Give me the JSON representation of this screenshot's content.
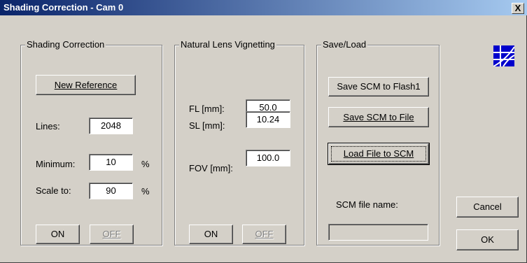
{
  "window": {
    "title": "Shading Correction - Cam 0",
    "close_glyph": "X"
  },
  "shading": {
    "legend": "Shading Correction",
    "new_reference": "New Reference",
    "lines_label": "Lines:",
    "lines_value": "2048",
    "minimum_label": "Minimum:",
    "minimum_value": "10",
    "minimum_unit": "%",
    "scale_label": "Scale to:",
    "scale_value": "90",
    "scale_unit": "%",
    "on_label": "ON",
    "off_label": "OFF"
  },
  "vignetting": {
    "legend": "Natural Lens Vignetting",
    "fl_label": "FL [mm]:",
    "fl_value": "50.0",
    "sl_label": "SL [mm]:",
    "sl_value": "10.24",
    "fov_label": "FOV [mm]:",
    "fov_value": "100.0",
    "on_label": "ON",
    "off_label": "OFF"
  },
  "saveload": {
    "legend": "Save/Load",
    "save_flash": "Save SCM to Flash1",
    "save_file": "Save SCM to File",
    "load_file": "Load File to SCM",
    "file_name_label": "SCM file name:",
    "file_name_value": ""
  },
  "actions": {
    "cancel": "Cancel",
    "ok": "OK"
  },
  "icon": {
    "name": "grid-logo-icon",
    "color": "#0000cc"
  }
}
